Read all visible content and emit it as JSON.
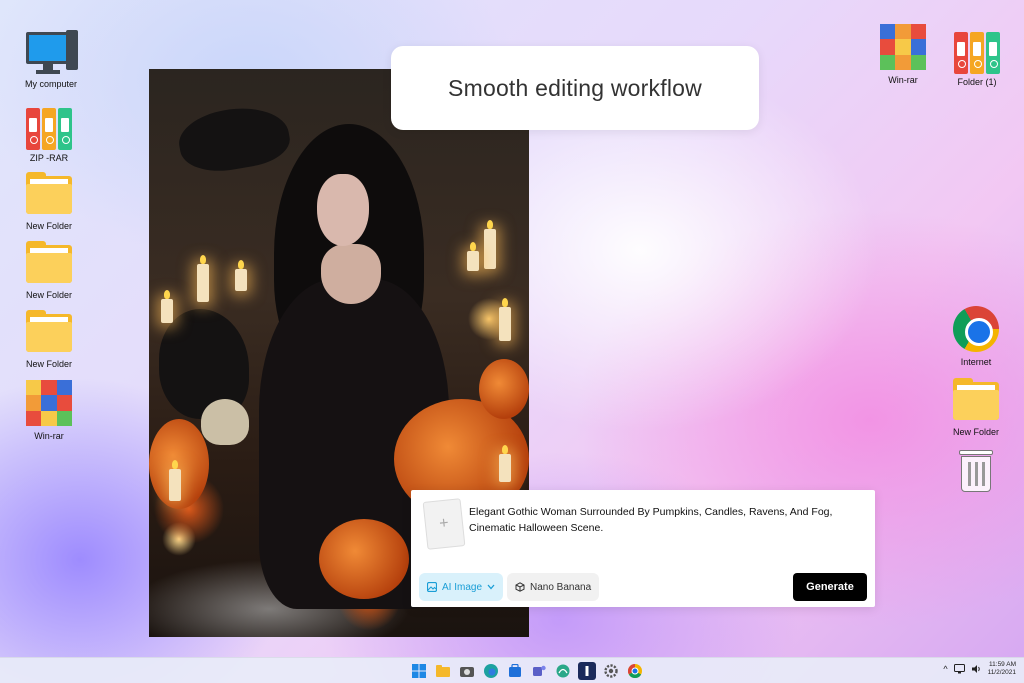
{
  "desktop": {
    "left_icons": [
      {
        "label": "My computer",
        "icon": "computer-icon"
      },
      {
        "label": "ZIP -RAR",
        "icon": "binders-icon"
      },
      {
        "label": "New Folder",
        "icon": "folder-icon"
      },
      {
        "label": "New Folder",
        "icon": "folder-icon"
      },
      {
        "label": "New Folder",
        "icon": "folder-icon"
      },
      {
        "label": "Win-rar",
        "icon": "winrar-icon"
      }
    ],
    "right_icons": [
      {
        "label": "Win-rar",
        "icon": "winrar-icon"
      },
      {
        "label": "Folder (1)",
        "icon": "binders-icon"
      },
      {
        "label": "Internet",
        "icon": "chrome-icon"
      },
      {
        "label": "New Folder",
        "icon": "folder-icon"
      },
      {
        "label": "",
        "icon": "recycle-bin-icon"
      }
    ]
  },
  "banner": {
    "title": "Smooth editing workflow"
  },
  "prompt_panel": {
    "upload_symbol": "+",
    "prompt_text": "Elegant Gothic Woman Surrounded By Pumpkins, Candles, Ravens, And Fog, Cinematic Halloween Scene.",
    "mode_chip_label": "AI Image",
    "model_chip_label": "Nano Banana",
    "generate_label": "Generate"
  },
  "taskbar": {
    "apps": [
      "windows-start-icon",
      "file-explorer-icon",
      "camera-icon",
      "edge-icon",
      "store-icon",
      "teams-icon",
      "maps-icon",
      "app-icon",
      "settings-icon",
      "chrome-icon"
    ],
    "tray_chevron": "^",
    "time": "11:59 AM",
    "date": "11/2/2021"
  },
  "colors": {
    "accent_chip_bg": "#d9f1fb",
    "accent_chip_text": "#1a9ed6",
    "generate_bg": "#000000",
    "folder_yellow": "#fcd05b"
  }
}
